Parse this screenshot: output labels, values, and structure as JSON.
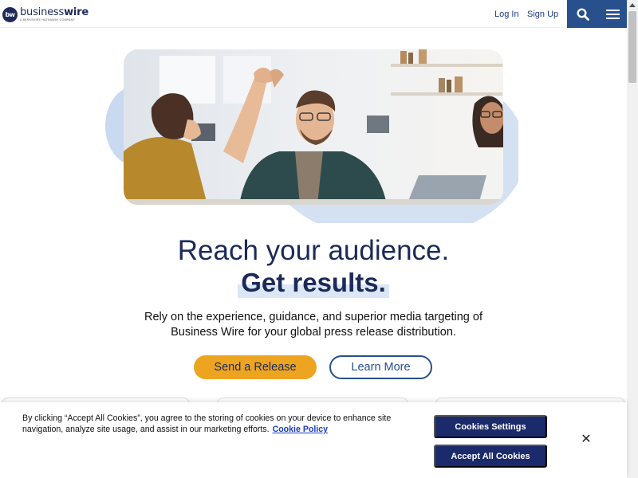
{
  "header": {
    "logo_mark": "bw",
    "logo_word_light": "business",
    "logo_word_bold": "wire",
    "logo_tagline": "A BERKSHIRE HATHAWAY COMPANY",
    "login_label": "Log In",
    "signup_label": "Sign Up",
    "search_icon": "search-icon",
    "menu_icon": "hamburger-menu-icon"
  },
  "hero": {
    "title_line1": "Reach your audience.",
    "title_line2": "Get results.",
    "body": "Rely on the experience, guidance, and superior media targeting of Business Wire for your global press release distribution.",
    "primary_button": "Send a Release",
    "secondary_button": "Learn More",
    "image": "photo-colleagues-high-five"
  },
  "cookie_banner": {
    "text": "By clicking “Accept All Cookies”, you agree to the storing of cookies on your device to enhance site navigation, analyze site usage, and assist in our marketing efforts.",
    "policy_link": "Cookie Policy",
    "settings_button": "Cookies Settings",
    "accept_button": "Accept All Cookies",
    "close_icon": "close-icon"
  },
  "colors": {
    "brand_navy": "#1b2a58",
    "header_button_blue": "#27508d",
    "accent_orange": "#eca421",
    "cookie_button": "#1b2a6b",
    "link_blue": "#1a3cc8"
  }
}
